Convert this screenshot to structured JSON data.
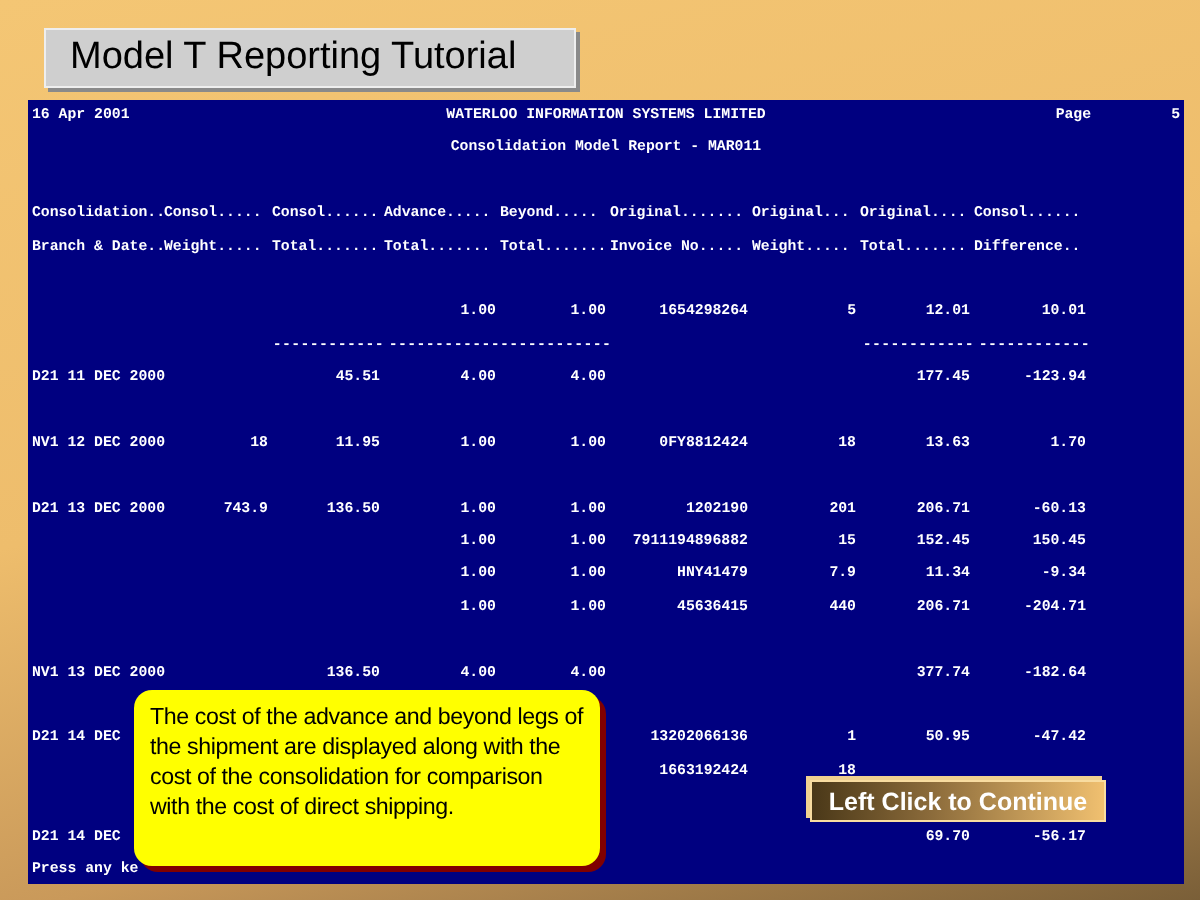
{
  "slide_title": "Model T Reporting Tutorial",
  "report": {
    "date": "16 Apr 2001",
    "company": "WATERLOO INFORMATION SYSTEMS LIMITED",
    "page_label": "Page",
    "page_number": "5",
    "title": "Consolidation Model Report - MAR011",
    "header_rows": [
      {
        "branch_date": "Consolidation..",
        "consol_weight": "Consol.....",
        "consol_total": "Consol......",
        "advance_total": "Advance.....",
        "beyond_total": "Beyond.....",
        "invoice_no": "Original.......",
        "orig_weight": "Original...",
        "orig_total": "Original....",
        "consol_difference": "Consol......"
      },
      {
        "branch_date": "Branch & Date..",
        "consol_weight": "Weight.....",
        "consol_total": "Total.......",
        "advance_total": "Total.......",
        "beyond_total": "Total.......",
        "invoice_no": "Invoice No.....",
        "orig_weight": "Weight.....",
        "orig_total": "Total.......",
        "consol_difference": "Difference.."
      }
    ],
    "rows": [
      {
        "kind": "data",
        "space_before": true,
        "advance_total": "1.00",
        "beyond_total": "1.00",
        "invoice_no": "1654298264",
        "orig_weight": "5",
        "orig_total": "12.01",
        "consol_difference": "10.01"
      },
      {
        "kind": "rule",
        "space_before": false,
        "consol_total": "------------",
        "advance_total": "------------",
        "beyond_total": "------------",
        "orig_total": "------------",
        "consol_difference": "------------"
      },
      {
        "kind": "data",
        "space_before": false,
        "branch_date": "D21 11 DEC 2000",
        "consol_total": "45.51",
        "advance_total": "4.00",
        "beyond_total": "4.00",
        "orig_total": "177.45",
        "consol_difference": "-123.94"
      },
      {
        "kind": "data",
        "space_before": true,
        "branch_date": "NV1 12 DEC 2000",
        "consol_weight": "18",
        "consol_total": "11.95",
        "advance_total": "1.00",
        "beyond_total": "1.00",
        "invoice_no": "0FY8812424",
        "orig_weight": "18",
        "orig_total": "13.63",
        "consol_difference": "1.70"
      },
      {
        "kind": "data",
        "space_before": true,
        "branch_date": "D21 13 DEC 2000",
        "consol_weight": "743.9",
        "consol_total": "136.50",
        "advance_total": "1.00",
        "beyond_total": "1.00",
        "invoice_no": "1202190",
        "orig_weight": "201",
        "orig_total": "206.71",
        "consol_difference": "-60.13"
      },
      {
        "kind": "data",
        "space_before": false,
        "advance_total": "1.00",
        "beyond_total": "1.00",
        "invoice_no": "7911194896882",
        "orig_weight": "15",
        "orig_total": "152.45",
        "consol_difference": "150.45"
      },
      {
        "kind": "data",
        "space_before": false,
        "advance_total": "1.00",
        "beyond_total": "1.00",
        "invoice_no": "HNY41479",
        "orig_weight": "7.9",
        "orig_total": "11.34",
        "consol_difference": "-9.34"
      },
      {
        "kind": "data",
        "space_before": false,
        "advance_total": "1.00",
        "beyond_total": "1.00",
        "invoice_no": "45636415",
        "orig_weight": "440",
        "orig_total": "206.71",
        "consol_difference": "-204.71"
      },
      {
        "kind": "data",
        "space_before": true,
        "branch_date": "NV1 13 DEC 2000",
        "consol_total": "136.50",
        "advance_total": "4.00",
        "beyond_total": "4.00",
        "orig_total": "377.74",
        "consol_difference": "-182.64"
      },
      {
        "kind": "data",
        "space_before": true,
        "branch_date": "D21 14 DEC",
        "invoice_no": "13202066136",
        "orig_weight": "1",
        "orig_total": "50.95",
        "consol_difference": "-47.42"
      },
      {
        "kind": "data",
        "space_before": false,
        "invoice_no": "1663192424",
        "orig_weight": "18"
      },
      {
        "kind": "data",
        "space_before": true,
        "branch_date": "D21 14 DEC",
        "orig_total": "69.70",
        "consol_difference": "-56.17"
      }
    ],
    "prompt": "Press any ke"
  },
  "callout": "The cost of the advance and beyond  legs of the shipment are displayed along with the cost of the consolidation for comparison with the cost of direct shipping.",
  "continue_button": "Left Click to Continue"
}
